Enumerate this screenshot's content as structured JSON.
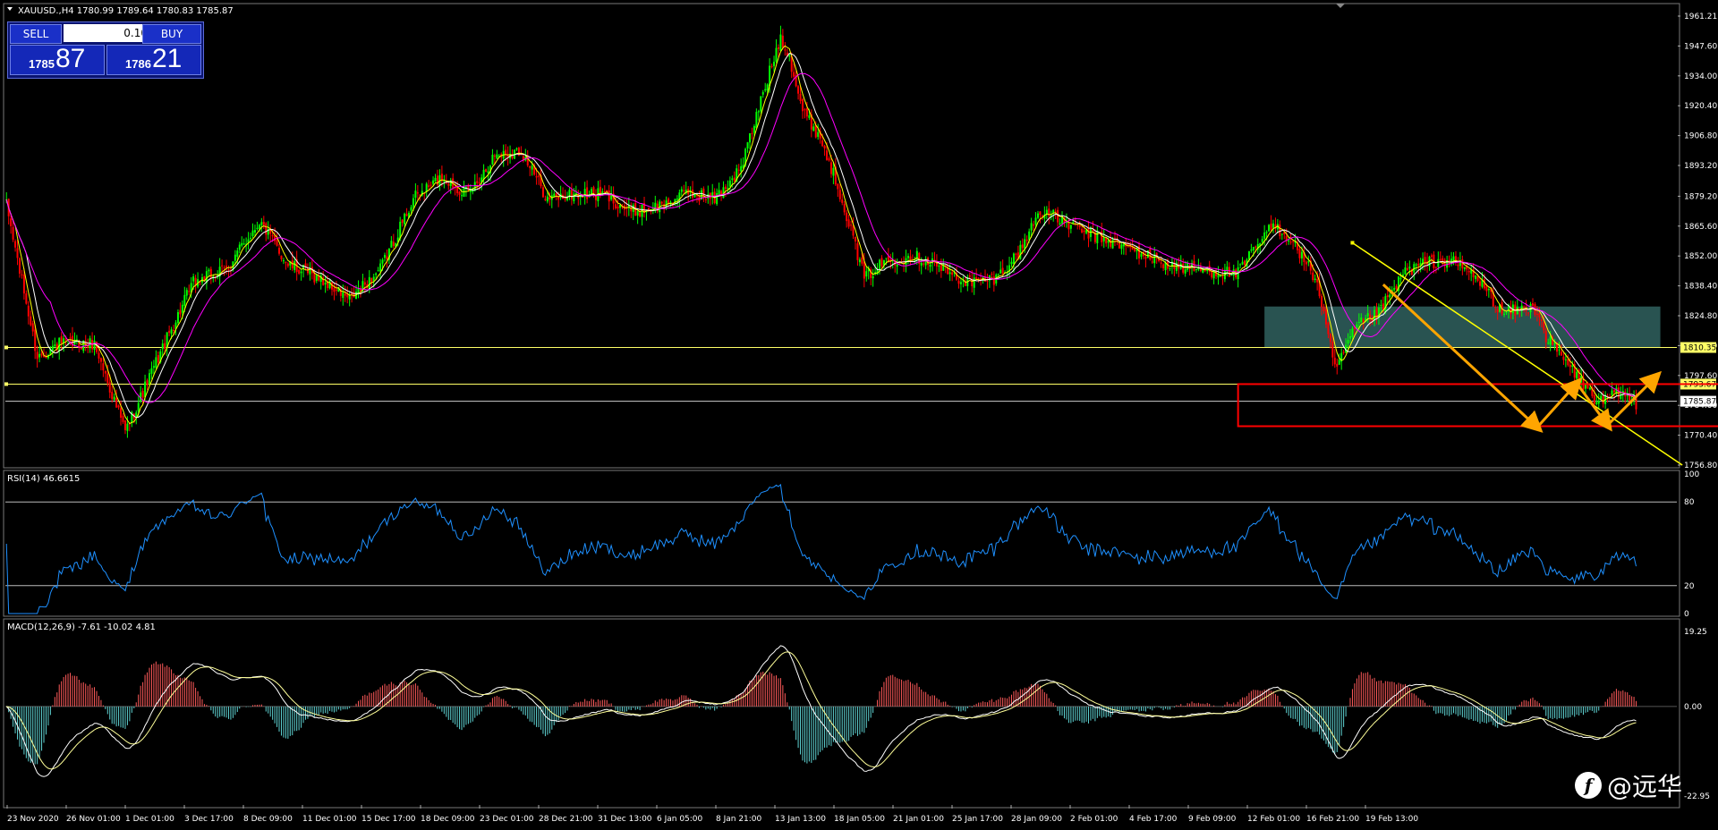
{
  "window": {
    "title": "XAUUSD.,H4 1780.99 1789.64 1780.83 1785.87"
  },
  "trade_panel": {
    "sell_label": "SELL",
    "buy_label": "BUY",
    "lot": "0.10",
    "sell_price_small": "1785",
    "sell_price_big": "87",
    "buy_price_small": "1786",
    "buy_price_big": "21"
  },
  "watermark": {
    "logo_glyph": "f",
    "text": "@远华"
  },
  "colors": {
    "bull": "#00ff00",
    "bear": "#ff0000",
    "ma_fast": "#ffff00",
    "ma_mid": "#ffffff",
    "ma_slow": "#ff00ff",
    "rsi": "#1e90ff",
    "macd_pos": "#ff5a5a",
    "macd_neg": "#5fd3d3",
    "signal": "#ffff99",
    "zone": "#2e5c5a",
    "box": "#ff0000",
    "arrow": "#ffa500",
    "trend": "#ffff00"
  },
  "chart_data": [
    {
      "type": "candlestick",
      "title": "XAUUSD.,H4 1780.99 1789.64 1780.83 1785.87",
      "ylim": [
        1756.8,
        1961.21
      ],
      "yticks": [
        "1961.21",
        "1947.60",
        "1934.00",
        "1920.40",
        "1906.80",
        "1893.20",
        "1879.20",
        "1865.60",
        "1852.00",
        "1838.40",
        "1824.80",
        "1811.20",
        "1797.60",
        "1784.00",
        "1770.40",
        "1756.80"
      ],
      "xticks": [
        "23 Nov 2020",
        "26 Nov 01:00",
        "1 Dec 01:00",
        "3 Dec 17:00",
        "8 Dec 09:00",
        "11 Dec 01:00",
        "15 Dec 17:00",
        "18 Dec 09:00",
        "23 Dec 01:00",
        "28 Dec 21:00",
        "31 Dec 13:00",
        "6 Jan 05:00",
        "8 Jan 21:00",
        "13 Jan 13:00",
        "18 Jan 05:00",
        "21 Jan 01:00",
        "25 Jan 17:00",
        "28 Jan 09:00",
        "2 Feb 01:00",
        "4 Feb 17:00",
        "9 Feb 09:00",
        "12 Feb 01:00",
        "16 Feb 21:00",
        "19 Feb 13:00"
      ],
      "path": [
        [
          0,
          1875
        ],
        [
          14,
          1806
        ],
        [
          24,
          1812
        ],
        [
          40,
          1812
        ],
        [
          54,
          1772
        ],
        [
          70,
          1808
        ],
        [
          85,
          1840
        ],
        [
          100,
          1846
        ],
        [
          115,
          1868
        ],
        [
          128,
          1848
        ],
        [
          142,
          1842
        ],
        [
          156,
          1832
        ],
        [
          170,
          1846
        ],
        [
          185,
          1878
        ],
        [
          198,
          1888
        ],
        [
          210,
          1880
        ],
        [
          222,
          1898
        ],
        [
          234,
          1900
        ],
        [
          246,
          1878
        ],
        [
          258,
          1880
        ],
        [
          272,
          1880
        ],
        [
          284,
          1872
        ],
        [
          298,
          1875
        ],
        [
          310,
          1881
        ],
        [
          322,
          1878
        ],
        [
          334,
          1892
        ],
        [
          344,
          1926
        ],
        [
          352,
          1952
        ],
        [
          356,
          1943
        ],
        [
          362,
          1918
        ],
        [
          370,
          1906
        ],
        [
          380,
          1878
        ],
        [
          390,
          1842
        ],
        [
          400,
          1850
        ],
        [
          412,
          1852
        ],
        [
          420,
          1850
        ],
        [
          432,
          1842
        ],
        [
          440,
          1840
        ],
        [
          450,
          1842
        ],
        [
          460,
          1853
        ],
        [
          470,
          1873
        ],
        [
          480,
          1868
        ],
        [
          492,
          1862
        ],
        [
          504,
          1858
        ],
        [
          516,
          1853
        ],
        [
          528,
          1848
        ],
        [
          540,
          1846
        ],
        [
          550,
          1845
        ],
        [
          560,
          1844
        ],
        [
          568,
          1856
        ],
        [
          576,
          1866
        ],
        [
          584,
          1860
        ],
        [
          596,
          1840
        ],
        [
          604,
          1800
        ],
        [
          614,
          1820
        ],
        [
          624,
          1826
        ],
        [
          636,
          1845
        ],
        [
          646,
          1849
        ],
        [
          656,
          1850
        ],
        [
          664,
          1846
        ],
        [
          672,
          1838
        ],
        [
          680,
          1826
        ],
        [
          690,
          1828
        ],
        [
          696,
          1828
        ],
        [
          700,
          1815
        ],
        [
          712,
          1800
        ],
        [
          724,
          1785
        ],
        [
          734,
          1790
        ],
        [
          742,
          1784
        ]
      ],
      "series": [
        {
          "name": "",
          "style": "bull/bear candles"
        }
      ],
      "levels": [
        {
          "label": "1810.35",
          "value": 1810.35
        },
        {
          "label": "1793.67",
          "value": 1793.67
        },
        {
          "label": "1785.87",
          "value": 1785.87
        }
      ],
      "zone": {
        "from_x": 572,
        "to_x": 752,
        "low": 1810.35,
        "high": 1829
      },
      "box": {
        "from_x": 560,
        "to_x": 908,
        "low": 1774.5,
        "high": 1793.67
      },
      "trendline": [
        [
          612,
          1858
        ],
        [
          762,
          1756.8
        ]
      ],
      "arrows": [
        [
          [
            626,
            1839
          ],
          [
            696,
            1774
          ]
        ],
        [
          [
            696,
            1774
          ],
          [
            714,
            1794
          ]
        ],
        [
          [
            714,
            1794
          ],
          [
            728,
            1775
          ]
        ],
        [
          [
            728,
            1775
          ],
          [
            750,
            1797
          ]
        ]
      ]
    },
    {
      "type": "line",
      "title": "RSI(14) 46.6615",
      "ylim": [
        0,
        100
      ],
      "yticks": [
        "100",
        "80",
        "20",
        "0"
      ],
      "levels": [
        80,
        20
      ],
      "series": [
        {
          "name": "RSI(14)",
          "values_sampled": "derived from price path"
        }
      ]
    },
    {
      "type": "bar",
      "title": "MACD(12,26,9) -7.61 -10.02 4.81",
      "ylim": [
        -22.95,
        19.25
      ],
      "yticks": [
        "19.25",
        "0.00",
        "-22.95"
      ],
      "series": [
        {
          "name": "MACD",
          "style": "histogram"
        },
        {
          "name": "Signal",
          "style": "line"
        }
      ]
    }
  ]
}
